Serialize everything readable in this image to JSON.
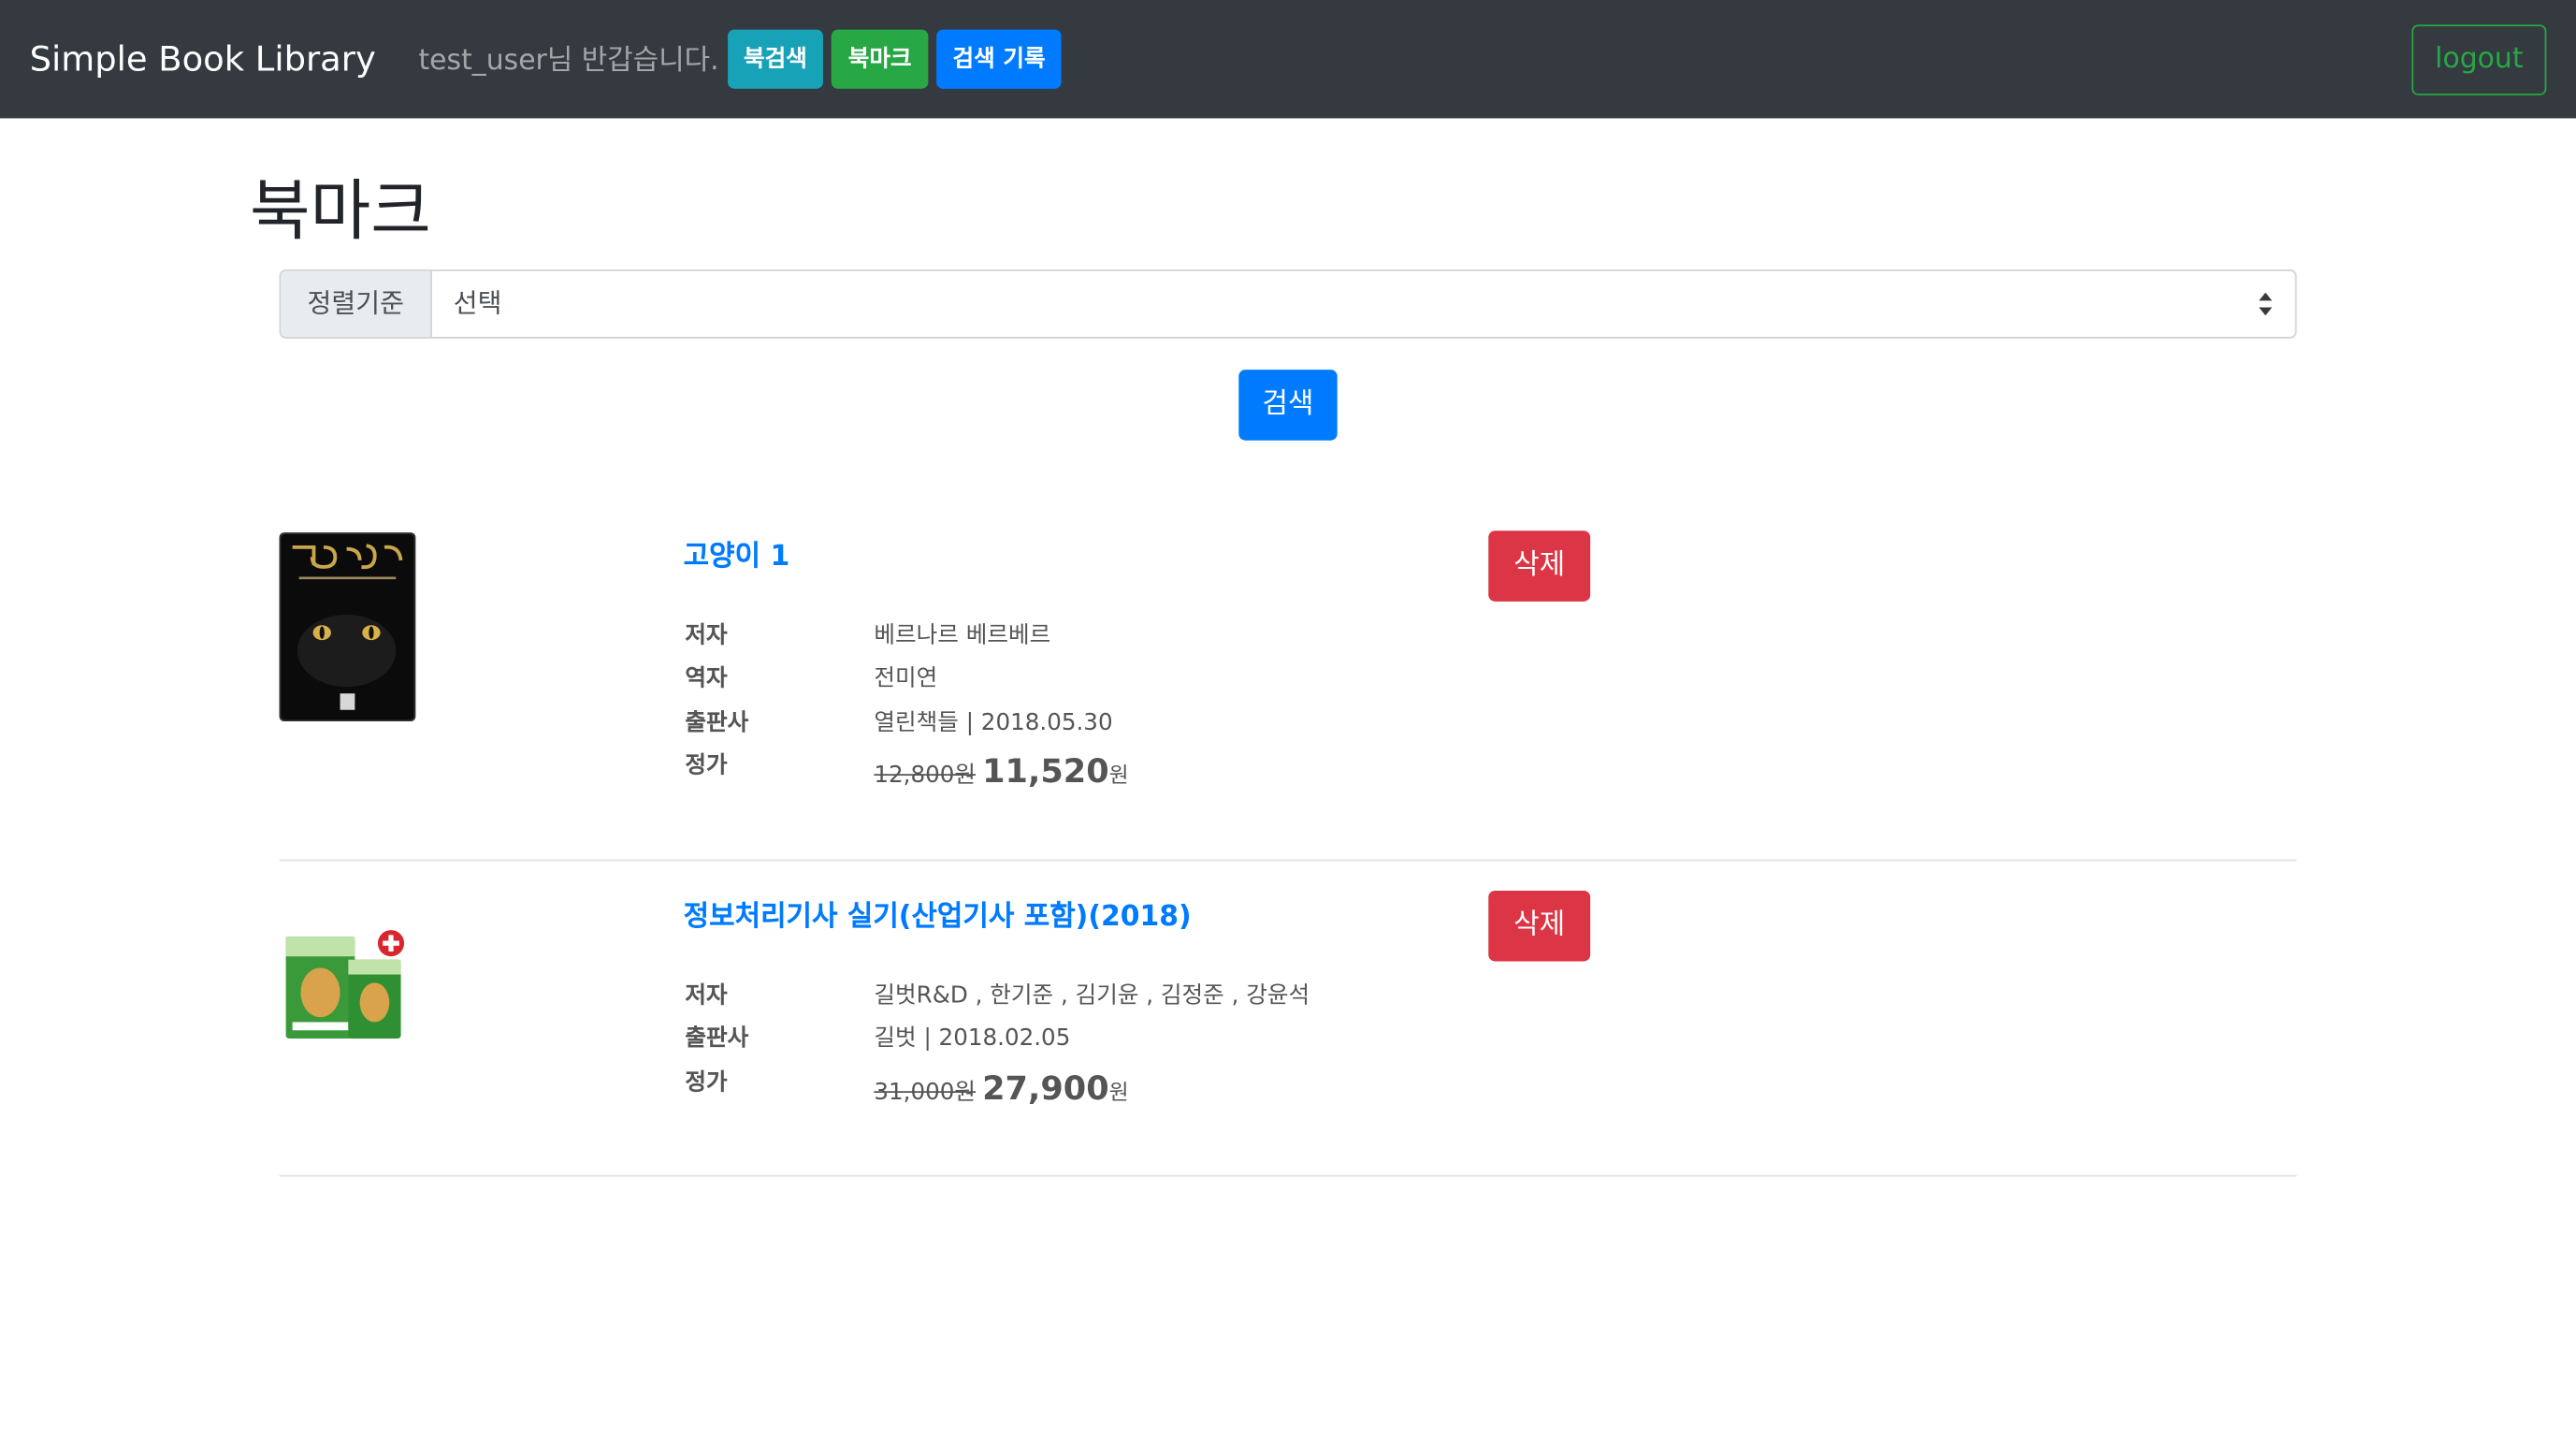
{
  "navbar": {
    "brand": "Simple Book Library",
    "greeting": "test_user님 반갑습니다.",
    "buttons": [
      {
        "label": "북검색",
        "color": "#17a2b8"
      },
      {
        "label": "북마크",
        "color": "#28a745"
      },
      {
        "label": "검색 기록",
        "color": "#007bff"
      }
    ],
    "logout_label": "logout"
  },
  "page": {
    "title": "북마크",
    "sort": {
      "label": "정렬기준",
      "selected": "선택"
    },
    "search_label": "검색"
  },
  "books": [
    {
      "title": "고양이 1",
      "delete_label": "삭제",
      "fields": [
        {
          "label": "저자",
          "value": "베르나르 베르베르"
        },
        {
          "label": "역자",
          "value": "전미연"
        },
        {
          "label": "출판사",
          "value": "열린책들 | 2018.05.30"
        }
      ],
      "price_label": "정가",
      "original_price": "12,800원",
      "sale_price": "11,520",
      "price_unit": "원",
      "cover_icon": "black-cat-book-cover"
    },
    {
      "title": "정보처리기사 실기(산업기사 포함)(2018)",
      "delete_label": "삭제",
      "fields": [
        {
          "label": "저자",
          "value": "길벗R&D , 한기준 , 김기윤 , 김정준 , 강윤석"
        },
        {
          "label": "출판사",
          "value": "길벗 | 2018.02.05"
        }
      ],
      "price_label": "정가",
      "original_price": "31,000원",
      "sale_price": "27,900",
      "price_unit": "원",
      "cover_icon": "green-textbook-set-cover"
    }
  ]
}
